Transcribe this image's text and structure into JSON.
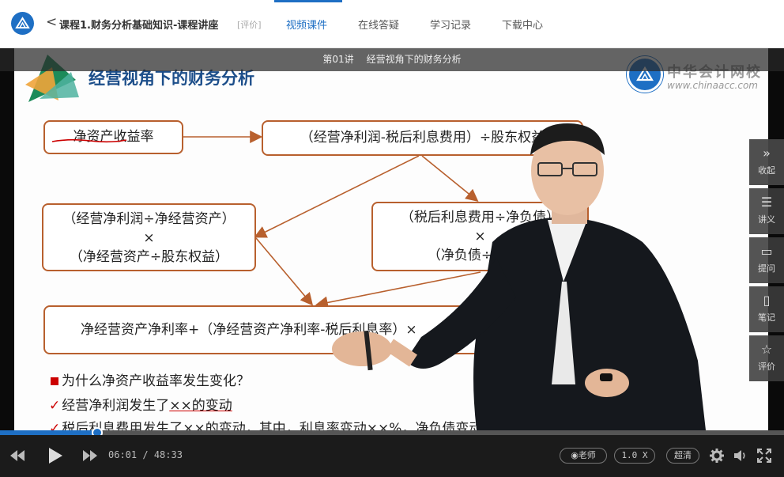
{
  "header": {
    "back_glyph": "<",
    "course_title": "课程1.财务分析基础知识-课程讲座",
    "rate_link": "[评价]",
    "tabs": [
      {
        "label": "视频课件",
        "active": true
      },
      {
        "label": "在线答疑",
        "active": false
      },
      {
        "label": "学习记录",
        "active": false
      },
      {
        "label": "下载中心",
        "active": false
      }
    ],
    "accent_color": "#1e6fc4"
  },
  "video": {
    "caption_lesson": "第01讲",
    "caption_title": "经营视角下的财务分析",
    "watermark_cn": "中华会计网校",
    "watermark_url": "www.chinaacc.com",
    "slide": {
      "title": "经营视角下的财务分析",
      "box1": "净资产收益率",
      "box2": "（经营净利润-税后利息费用）÷股东权益",
      "box3_line1": "（经营净利润÷净经营资产）",
      "box3_line2": "×",
      "box3_line3": "（净经营资产÷股东权益）",
      "box4_line1": "（税后利息费用÷净负债）",
      "box4_line2": "×",
      "box4_line3": "（净负债÷股东权",
      "box5": "净经营资产净利率+（净经营资产净利率-税后利息率）×",
      "question": "为什么净资产收益率发生变化？",
      "check1_prefix": "经营净利润发生了",
      "check1_mark": "××的变动",
      "check2": "税后利息费用发生了××的变动，其中，利息率变动××%，净负债变动",
      "check_glyph": "✓"
    }
  },
  "side_panel": [
    {
      "icon": "»",
      "label": "收起"
    },
    {
      "icon": "☰",
      "label": "讲义"
    },
    {
      "icon": "▭",
      "label": "提问"
    },
    {
      "icon": "▯",
      "label": "笔记"
    },
    {
      "icon": "☆",
      "label": "评价"
    }
  ],
  "player": {
    "current_time": "06:01",
    "total_time": "48:33",
    "time_separator": "/",
    "progress_fraction": 0.124,
    "teacher_toggle": "◉老师",
    "speed": "1.0 X",
    "quality": "超清"
  }
}
